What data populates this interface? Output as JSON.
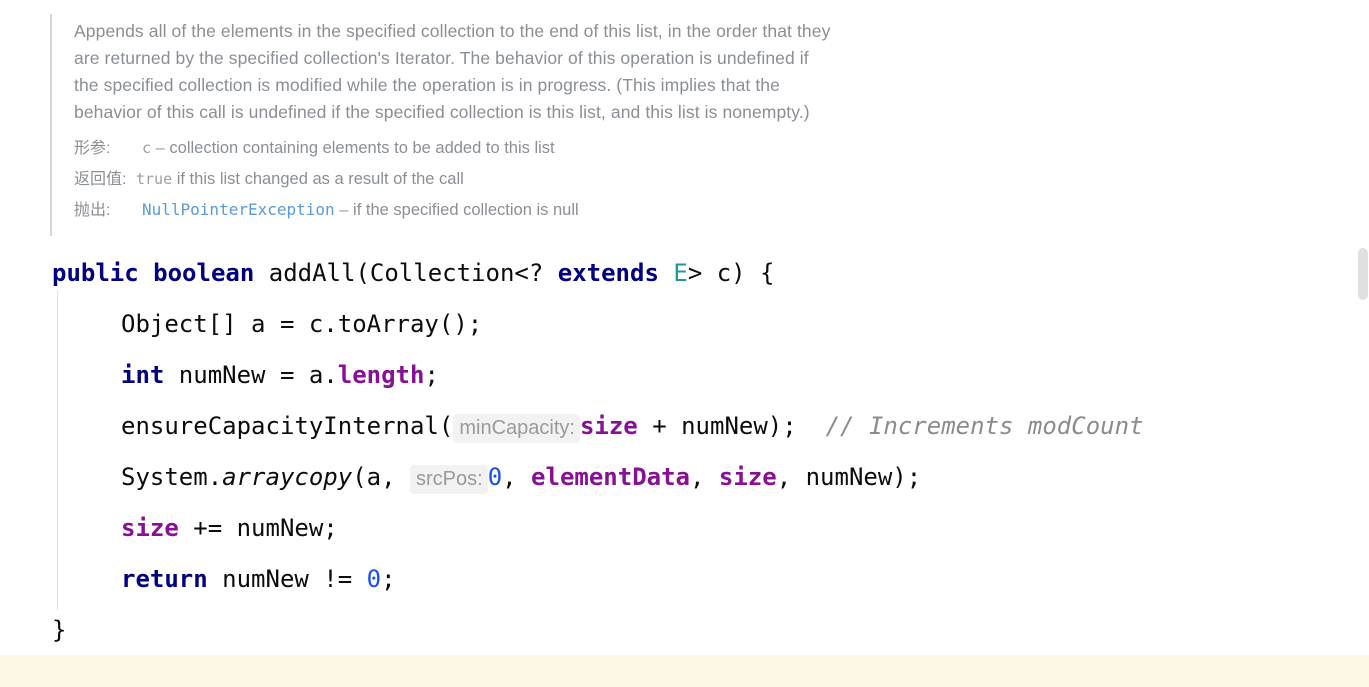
{
  "doc": {
    "description_lines": [
      "Appends all of the elements in the specified collection to the end of this list, in the order that they",
      "are returned by the specified collection's Iterator. The behavior of this operation is undefined if",
      "the specified collection is modified while the operation is in progress. (This implies that the",
      "behavior of this call is undefined if the specified collection is this list, and this list is nonempty.)"
    ],
    "params_label": "形参:",
    "param_name": "c",
    "param_dash": "–",
    "param_desc": "collection containing elements to be added to this list",
    "returns_label": "返回值:",
    "returns_code": "true",
    "returns_desc": "if this list changed as a result of the call",
    "throws_label": "抛出:",
    "throws_type": "NullPointerException",
    "throws_dash": "–",
    "throws_desc": "if the specified collection is null"
  },
  "code": {
    "signature": {
      "kw_public": "public",
      "kw_boolean": "boolean",
      "name_open": " addAll(Collection<? ",
      "kw_extends": "extends",
      "space": " ",
      "typeparam_e": "E",
      "tail": "> c) {"
    },
    "line_to_array": "Object[] a = c.toArray();",
    "line_numnew": {
      "kw_int": "int",
      "mid": " numNew = a.",
      "field_length": "length",
      "tail": ";"
    },
    "line_ensure": {
      "call": "ensureCapacityInternal(",
      "hint": "minCapacity:",
      "field_size": "size",
      "mid": " + numNew);",
      "comment": "// Increments modCount"
    },
    "line_arraycopy": {
      "prefix": "System.",
      "static_method": "arraycopy",
      "open": "(a, ",
      "hint": "srcPos:",
      "num_zero": "0",
      "comma1": ", ",
      "field_elementdata": "elementData",
      "comma2": ", ",
      "field_size": "size",
      "tail": ", numNew);"
    },
    "line_size_plus": {
      "field_size": "size",
      "tail": " += numNew;"
    },
    "line_return": {
      "kw_return": "return",
      "mid": " numNew != ",
      "num_zero": "0",
      "tail": ";"
    },
    "closing_brace": "}"
  },
  "colors": {
    "keyword": "#000080",
    "field": "#871094",
    "number": "#1750eb",
    "type_param": "#20999d",
    "comment": "#8c8c8c",
    "doc_text": "#8a8f95",
    "link": "#5a9bd8",
    "hint_bg": "#f2f2f2",
    "highlight_band": "#fdf8e6",
    "scrollbar_thumb": "#e0e0e0"
  }
}
